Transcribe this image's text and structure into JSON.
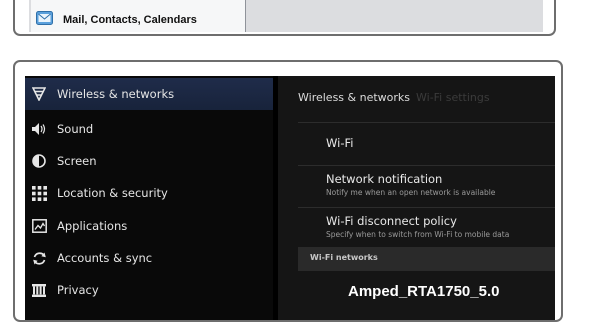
{
  "top_panel": {
    "item_label": "Mail, Contacts, Calendars",
    "item_icon": "mail-icon"
  },
  "settings": {
    "sidebar": {
      "items": [
        {
          "label": "Wireless & networks",
          "icon": "wifi-icon",
          "selected": true
        },
        {
          "label": "Sound",
          "icon": "speaker-icon",
          "selected": false
        },
        {
          "label": "Screen",
          "icon": "brightness-icon",
          "selected": false
        },
        {
          "label": "Location & security",
          "icon": "location-grid-icon",
          "selected": false
        },
        {
          "label": "Applications",
          "icon": "applications-icon",
          "selected": false
        },
        {
          "label": "Accounts & sync",
          "icon": "sync-icon",
          "selected": false
        },
        {
          "label": "Privacy",
          "icon": "privacy-icon",
          "selected": false
        }
      ]
    },
    "breadcrumb": {
      "current": "Wireless & networks",
      "next": "Wi-Fi settings"
    },
    "prefs": {
      "wifi": {
        "title": "Wi-Fi"
      },
      "network_notification": {
        "title": "Network notification",
        "summary": "Notify me when an open network is available"
      },
      "disconnect_policy": {
        "title": "Wi-Fi disconnect policy",
        "summary": "Specify when to switch from Wi-Fi to mobile data"
      }
    },
    "section": {
      "title": "Wi-Fi networks"
    },
    "network": {
      "name": "Amped_RTA1750_5.0"
    }
  }
}
